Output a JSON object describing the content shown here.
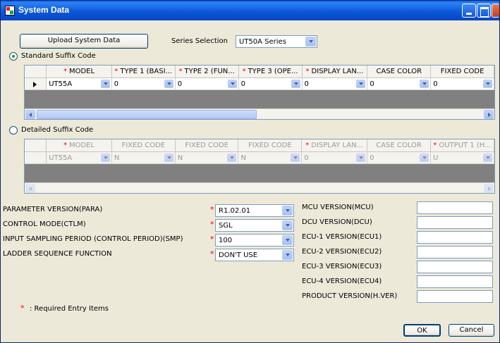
{
  "window": {
    "title": "System Data"
  },
  "toolbar": {
    "upload_label": "Upload System Data"
  },
  "series": {
    "label": "Series Selection",
    "value": "UT50A Series"
  },
  "standard": {
    "radio_label": "Standard Suffix Code",
    "columns": [
      "MODEL",
      "TYPE 1 (BASI...",
      "TYPE 2 (FUN...",
      "TYPE 3 (OPE...",
      "DISPLAY LAN...",
      "CASE COLOR",
      "FIXED CODE"
    ],
    "required": [
      true,
      true,
      true,
      true,
      true,
      false,
      false
    ],
    "row": [
      "UT55A",
      "0",
      "0",
      "0",
      "0",
      "0",
      "0"
    ]
  },
  "detailed": {
    "radio_label": "Detailed Suffix Code",
    "columns": [
      "MODEL",
      "FIXED CODE",
      "FIXED CODE",
      "FIXED CODE",
      "DISPLAY LAN...",
      "CASE COLOR",
      "OUTPUT 1 (H..."
    ],
    "required": [
      true,
      false,
      false,
      false,
      true,
      false,
      true
    ],
    "row": [
      "UT55A",
      "N",
      "N",
      "N",
      "0",
      "0",
      "U"
    ]
  },
  "params": [
    {
      "label": "PARAMETER VERSION(PARA)",
      "value": "R1.02.01"
    },
    {
      "label": "CONTROL MODE(CTLM)",
      "value": "SGL"
    },
    {
      "label": "INPUT SAMPLING PERIOD (CONTROL PERIOD)(SMP)",
      "value": "100"
    },
    {
      "label": "LADDER SEQUENCE FUNCTION",
      "value": "DON'T USE"
    }
  ],
  "versions": [
    {
      "label": "MCU VERSION(MCU)",
      "value": ""
    },
    {
      "label": "DCU VERSION(DCU)",
      "value": ""
    },
    {
      "label": "ECU-1 VERSION(ECU1)",
      "value": ""
    },
    {
      "label": "ECU-2 VERSION(ECU2)",
      "value": ""
    },
    {
      "label": "ECU-3 VERSION(ECU3)",
      "value": ""
    },
    {
      "label": "ECU-4 VERSION(ECU4)",
      "value": ""
    },
    {
      "label": "PRODUCT VERSION(H.VER)",
      "value": ""
    }
  ],
  "footer": {
    "required_note": ": Required Entry Items",
    "ok_label": "OK",
    "cancel_label": "Cancel"
  },
  "colors": {
    "title_bar": "#0a5fe8",
    "required": "#e00000",
    "grid_empty": "#808080"
  }
}
